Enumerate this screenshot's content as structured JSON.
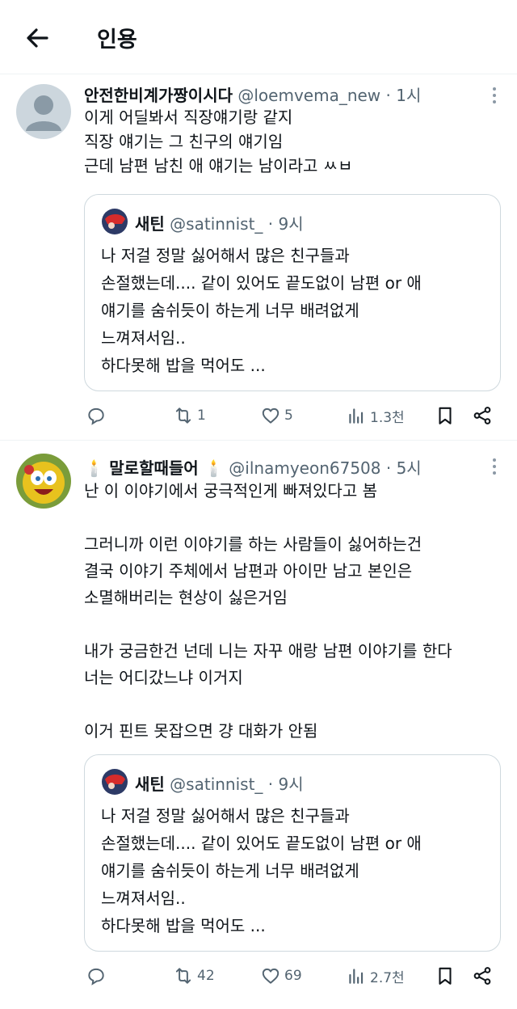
{
  "header": {
    "title": "인용"
  },
  "tweets": [
    {
      "name": "안전한비계가짱이시다",
      "handle": "@loemvema_new",
      "time": "1시",
      "lines": [
        "이게 어딜봐서 직장얘기랑 같지",
        "직장 얘기는 그 친구의 얘기임",
        "근데 남편 남친 애 얘기는 남이라고 ㅆㅂ"
      ],
      "quote": {
        "name": "새틴",
        "handle": "@satinnist_",
        "time": "9시",
        "lines": [
          "나 저걸 정말 싫어해서 많은 친구들과",
          "손절했는데.... 같이 있어도 끝도없이 남편 or 애",
          "얘기를 숨쉬듯이 하는게 너무 배려없게",
          "느껴져서임..",
          "하다못해 밥을 먹어도 ..."
        ]
      },
      "actions": {
        "retweets": "1",
        "likes": "5",
        "views": "1.3천"
      }
    },
    {
      "name": "말로할때들어",
      "handle": "@ilnamyeon67508",
      "time": "5시",
      "lines": [
        "난 이 이야기에서 궁극적인게 빠져있다고 봄",
        "",
        "그러니까 이런 이야기를 하는 사람들이 싫어하는건",
        "결국 이야기 주체에서 남편과 아이만 남고 본인은",
        "소멸해버리는 현상이 싫은거임",
        "",
        "내가 궁금한건 넌데 니는 자꾸 애랑 남편 이야기를 한다",
        "너는 어디갔느냐 이거지",
        "",
        "이거 핀트 못잡으면 걍 대화가 안됨"
      ],
      "quote": {
        "name": "새틴",
        "handle": "@satinnist_",
        "time": "9시",
        "lines": [
          "나 저걸 정말 싫어해서 많은 친구들과",
          "손절했는데.... 같이 있어도 끝도없이 남편 or 애",
          "얘기를 숨쉬듯이 하는게 너무 배려없게",
          "느껴져서임..",
          "하다못해 밥을 먹어도 ..."
        ]
      },
      "actions": {
        "retweets": "42",
        "likes": "69",
        "views": "2.7천"
      }
    }
  ],
  "separator_dot": "·",
  "colors": {
    "text": "#0f1419",
    "secondary": "#536471",
    "border": "#cfd9de"
  }
}
